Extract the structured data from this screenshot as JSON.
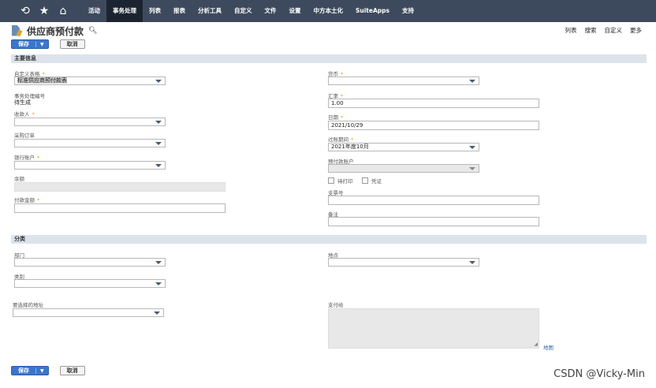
{
  "nav": {
    "icons": [
      "recent-icon",
      "star-icon",
      "home-icon"
    ],
    "items": [
      {
        "label": "活动",
        "active": false
      },
      {
        "label": "事务处理",
        "active": true
      },
      {
        "label": "列表",
        "active": false
      },
      {
        "label": "报表",
        "active": false
      },
      {
        "label": "分析工具",
        "active": false
      },
      {
        "label": "自定义",
        "active": false
      },
      {
        "label": "文件",
        "active": false
      },
      {
        "label": "设置",
        "active": false
      },
      {
        "label": "中方本土化",
        "active": false
      },
      {
        "label": "SuiteApps",
        "active": false
      },
      {
        "label": "支持",
        "active": false
      }
    ]
  },
  "page": {
    "title": "供应商预付款",
    "links": [
      "列表",
      "搜索",
      "自定义",
      "更多"
    ]
  },
  "buttons": {
    "save": "保存",
    "cancel": "取消"
  },
  "sections": {
    "main": "主要信息",
    "classification": "分类"
  },
  "fields": {
    "custom_form": {
      "label": "自定义表格",
      "value": "标准供应商预付款表"
    },
    "txn_number": {
      "label": "事务处理编号",
      "value": "待生成"
    },
    "payee": {
      "label": "收款人",
      "value": ""
    },
    "purchase_order": {
      "label": "采购订单",
      "value": ""
    },
    "bank_account": {
      "label": "银行账户",
      "value": ""
    },
    "balance": {
      "label": "余额",
      "value": ""
    },
    "payment_amount": {
      "label": "付款金额",
      "value": ""
    },
    "currency": {
      "label": "货币",
      "value": ""
    },
    "exchange_rate": {
      "label": "汇率",
      "value": "1.00"
    },
    "date": {
      "label": "日期",
      "value": "2021/10/29"
    },
    "posting_period": {
      "label": "过账期间",
      "value": "2021年度10月"
    },
    "prepayment_account": {
      "label": "预付款账户",
      "value": ""
    },
    "to_print": {
      "label": "待打印"
    },
    "voucher": {
      "label": "凭证"
    },
    "check_number": {
      "label": "支票号",
      "value": ""
    },
    "memo": {
      "label": "备注",
      "value": ""
    },
    "department": {
      "label": "部门",
      "value": ""
    },
    "location": {
      "label": "地点",
      "value": ""
    },
    "category": {
      "label": "类别",
      "value": ""
    },
    "select_address": {
      "label": "要选择的地址",
      "value": ""
    },
    "pay_to": {
      "label": "支付给",
      "value": ""
    },
    "map": "地图"
  },
  "watermark": "CSDN @Vicky-Min"
}
